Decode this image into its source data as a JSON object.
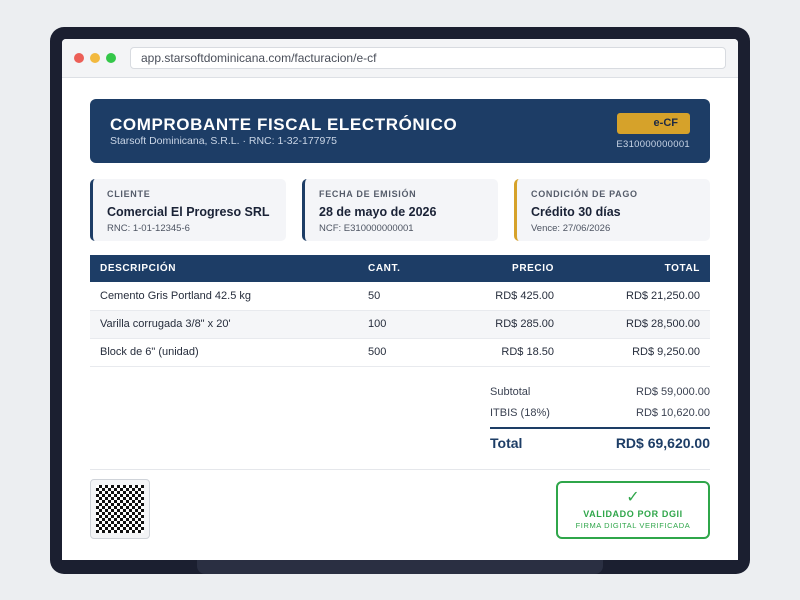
{
  "browser": {
    "url": "app.starsoftdominicana.com/facturacion/e-cf"
  },
  "header": {
    "title": "COMPROBANTE FISCAL ELECTRÓNICO",
    "subtitle": "Starsoft Dominicana, S.R.L. · RNC: 1-32-177975",
    "badge": "e-CF",
    "ncf": "E310000000001"
  },
  "cards": [
    {
      "label": "CLIENTE",
      "value": "Comercial El Progreso SRL",
      "sub": "RNC: 1-01-12345-6"
    },
    {
      "label": "FECHA DE EMISIÓN",
      "value": "28 de mayo de 2026",
      "sub": "NCF: E310000000001"
    },
    {
      "label": "CONDICIÓN DE PAGO",
      "value": "Crédito 30 días",
      "sub": "Vence: 27/06/2026"
    }
  ],
  "table": {
    "headers": [
      "DESCRIPCIÓN",
      "CANT.",
      "PRECIO",
      "TOTAL"
    ],
    "rows": [
      {
        "description": "Cemento Gris Portland 42.5 kg",
        "qty": "50",
        "price": "RD$ 425.00",
        "total": "RD$ 21,250.00"
      },
      {
        "description": "Varilla corrugada 3/8\" x 20'",
        "qty": "100",
        "price": "RD$ 285.00",
        "total": "RD$ 28,500.00"
      },
      {
        "description": "Block de 6\" (unidad)",
        "qty": "500",
        "price": "RD$ 18.50",
        "total": "RD$ 9,250.00"
      }
    ]
  },
  "totals": {
    "subtotal_label": "Subtotal",
    "subtotal_value": "RD$ 59,000.00",
    "tax_label": "ITBIS (18%)",
    "tax_value": "RD$ 10,620.00",
    "total_label": "Total",
    "total_value": "RD$ 69,620.00"
  },
  "validation": {
    "icon": "check-icon",
    "title": "VALIDADO POR DGII",
    "subtitle": "FIRMA DIGITAL VERIFICADA"
  },
  "colors": {
    "primary": "#1d3d66",
    "accent": "#d6a22a",
    "success": "#2fa64a"
  }
}
